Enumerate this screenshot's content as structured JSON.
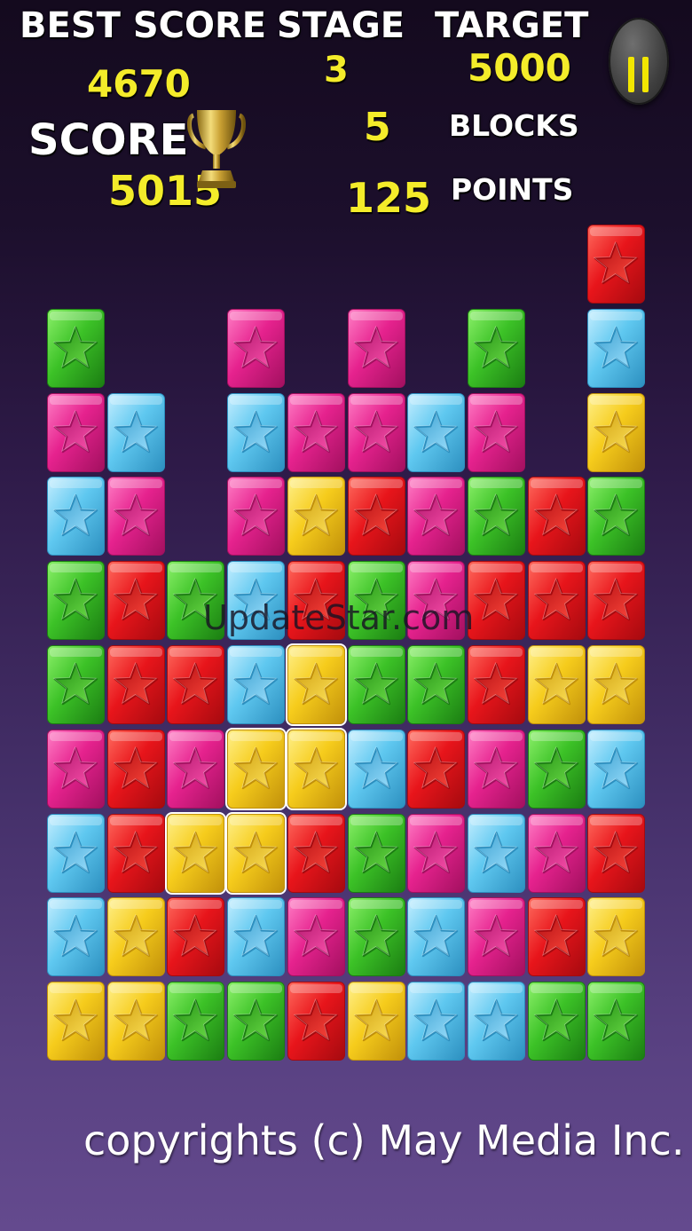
{
  "hud": {
    "best_score_label": "BEST SCORE",
    "best_score_value": "4670",
    "stage_label": "STAGE",
    "stage_value": "3",
    "target_label": "TARGET",
    "target_value": "5000",
    "score_label": "SCORE",
    "score_value": "5015",
    "selected_blocks_value": "5",
    "blocks_label": "BLOCKS",
    "selected_points_value": "125",
    "points_label": "POINTS"
  },
  "pause_icon": "pause-icon",
  "trophy_icon": "trophy-icon",
  "colors": {
    "red": "#e8151b",
    "pink": "#e6228e",
    "blue": "#5fc8f0",
    "green": "#3cc227",
    "yellow": "#f6cc1c",
    "hud_value": "#f4ec2a"
  },
  "board": {
    "columns": 10,
    "rows": 10,
    "grid": [
      [
        null,
        null,
        null,
        null,
        null,
        null,
        null,
        null,
        null,
        "red"
      ],
      [
        "green",
        null,
        null,
        "pink",
        null,
        "pink",
        null,
        "green",
        null,
        "blue"
      ],
      [
        "pink",
        "blue",
        null,
        "blue",
        "pink",
        "pink",
        "blue",
        "pink",
        null,
        "yellow"
      ],
      [
        "blue",
        "pink",
        null,
        "pink",
        "yellow",
        "red",
        "pink",
        "green",
        "red",
        "green"
      ],
      [
        "green",
        "red",
        "green",
        "blue",
        "red",
        "green",
        "pink",
        "red",
        "red",
        "red"
      ],
      [
        "green",
        "red",
        "red",
        "blue",
        "yellow",
        "green",
        "green",
        "red",
        "yellow",
        "yellow"
      ],
      [
        "pink",
        "red",
        "pink",
        "yellow",
        "yellow",
        "blue",
        "red",
        "pink",
        "green",
        "blue"
      ],
      [
        "blue",
        "red",
        "yellow",
        "yellow",
        "red",
        "green",
        "pink",
        "blue",
        "pink",
        "red"
      ],
      [
        "blue",
        "yellow",
        "red",
        "blue",
        "pink",
        "green",
        "blue",
        "pink",
        "red",
        "yellow"
      ],
      [
        "yellow",
        "yellow",
        "green",
        "green",
        "red",
        "yellow",
        "blue",
        "blue",
        "green",
        "green"
      ]
    ],
    "selected": [
      [
        5,
        4
      ],
      [
        6,
        3
      ],
      [
        6,
        4
      ],
      [
        7,
        2
      ],
      [
        7,
        3
      ]
    ],
    "block_icon": "star-icon"
  },
  "watermark": "UpdateStar.com",
  "copyright": "copyrights (c) May Media Inc."
}
